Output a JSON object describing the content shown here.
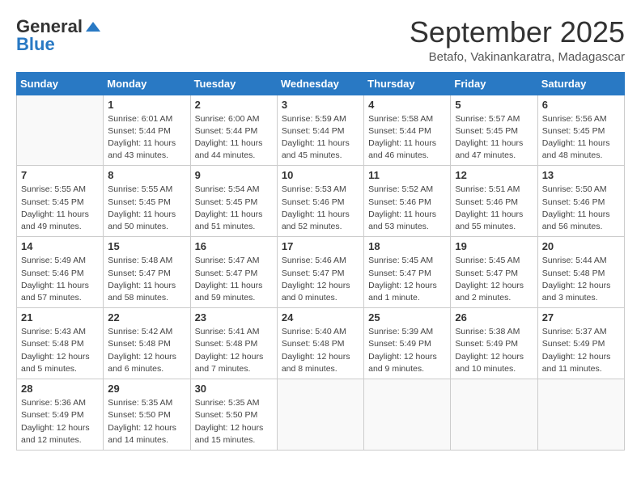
{
  "header": {
    "logo_general": "General",
    "logo_blue": "Blue",
    "month": "September 2025",
    "location": "Betafo, Vakinankaratra, Madagascar"
  },
  "weekdays": [
    "Sunday",
    "Monday",
    "Tuesday",
    "Wednesday",
    "Thursday",
    "Friday",
    "Saturday"
  ],
  "weeks": [
    [
      {
        "day": "",
        "sunrise": "",
        "sunset": "",
        "daylight": ""
      },
      {
        "day": "1",
        "sunrise": "Sunrise: 6:01 AM",
        "sunset": "Sunset: 5:44 PM",
        "daylight": "Daylight: 11 hours and 43 minutes."
      },
      {
        "day": "2",
        "sunrise": "Sunrise: 6:00 AM",
        "sunset": "Sunset: 5:44 PM",
        "daylight": "Daylight: 11 hours and 44 minutes."
      },
      {
        "day": "3",
        "sunrise": "Sunrise: 5:59 AM",
        "sunset": "Sunset: 5:44 PM",
        "daylight": "Daylight: 11 hours and 45 minutes."
      },
      {
        "day": "4",
        "sunrise": "Sunrise: 5:58 AM",
        "sunset": "Sunset: 5:44 PM",
        "daylight": "Daylight: 11 hours and 46 minutes."
      },
      {
        "day": "5",
        "sunrise": "Sunrise: 5:57 AM",
        "sunset": "Sunset: 5:45 PM",
        "daylight": "Daylight: 11 hours and 47 minutes."
      },
      {
        "day": "6",
        "sunrise": "Sunrise: 5:56 AM",
        "sunset": "Sunset: 5:45 PM",
        "daylight": "Daylight: 11 hours and 48 minutes."
      }
    ],
    [
      {
        "day": "7",
        "sunrise": "Sunrise: 5:55 AM",
        "sunset": "Sunset: 5:45 PM",
        "daylight": "Daylight: 11 hours and 49 minutes."
      },
      {
        "day": "8",
        "sunrise": "Sunrise: 5:55 AM",
        "sunset": "Sunset: 5:45 PM",
        "daylight": "Daylight: 11 hours and 50 minutes."
      },
      {
        "day": "9",
        "sunrise": "Sunrise: 5:54 AM",
        "sunset": "Sunset: 5:45 PM",
        "daylight": "Daylight: 11 hours and 51 minutes."
      },
      {
        "day": "10",
        "sunrise": "Sunrise: 5:53 AM",
        "sunset": "Sunset: 5:46 PM",
        "daylight": "Daylight: 11 hours and 52 minutes."
      },
      {
        "day": "11",
        "sunrise": "Sunrise: 5:52 AM",
        "sunset": "Sunset: 5:46 PM",
        "daylight": "Daylight: 11 hours and 53 minutes."
      },
      {
        "day": "12",
        "sunrise": "Sunrise: 5:51 AM",
        "sunset": "Sunset: 5:46 PM",
        "daylight": "Daylight: 11 hours and 55 minutes."
      },
      {
        "day": "13",
        "sunrise": "Sunrise: 5:50 AM",
        "sunset": "Sunset: 5:46 PM",
        "daylight": "Daylight: 11 hours and 56 minutes."
      }
    ],
    [
      {
        "day": "14",
        "sunrise": "Sunrise: 5:49 AM",
        "sunset": "Sunset: 5:46 PM",
        "daylight": "Daylight: 11 hours and 57 minutes."
      },
      {
        "day": "15",
        "sunrise": "Sunrise: 5:48 AM",
        "sunset": "Sunset: 5:47 PM",
        "daylight": "Daylight: 11 hours and 58 minutes."
      },
      {
        "day": "16",
        "sunrise": "Sunrise: 5:47 AM",
        "sunset": "Sunset: 5:47 PM",
        "daylight": "Daylight: 11 hours and 59 minutes."
      },
      {
        "day": "17",
        "sunrise": "Sunrise: 5:46 AM",
        "sunset": "Sunset: 5:47 PM",
        "daylight": "Daylight: 12 hours and 0 minutes."
      },
      {
        "day": "18",
        "sunrise": "Sunrise: 5:45 AM",
        "sunset": "Sunset: 5:47 PM",
        "daylight": "Daylight: 12 hours and 1 minute."
      },
      {
        "day": "19",
        "sunrise": "Sunrise: 5:45 AM",
        "sunset": "Sunset: 5:47 PM",
        "daylight": "Daylight: 12 hours and 2 minutes."
      },
      {
        "day": "20",
        "sunrise": "Sunrise: 5:44 AM",
        "sunset": "Sunset: 5:48 PM",
        "daylight": "Daylight: 12 hours and 3 minutes."
      }
    ],
    [
      {
        "day": "21",
        "sunrise": "Sunrise: 5:43 AM",
        "sunset": "Sunset: 5:48 PM",
        "daylight": "Daylight: 12 hours and 5 minutes."
      },
      {
        "day": "22",
        "sunrise": "Sunrise: 5:42 AM",
        "sunset": "Sunset: 5:48 PM",
        "daylight": "Daylight: 12 hours and 6 minutes."
      },
      {
        "day": "23",
        "sunrise": "Sunrise: 5:41 AM",
        "sunset": "Sunset: 5:48 PM",
        "daylight": "Daylight: 12 hours and 7 minutes."
      },
      {
        "day": "24",
        "sunrise": "Sunrise: 5:40 AM",
        "sunset": "Sunset: 5:48 PM",
        "daylight": "Daylight: 12 hours and 8 minutes."
      },
      {
        "day": "25",
        "sunrise": "Sunrise: 5:39 AM",
        "sunset": "Sunset: 5:49 PM",
        "daylight": "Daylight: 12 hours and 9 minutes."
      },
      {
        "day": "26",
        "sunrise": "Sunrise: 5:38 AM",
        "sunset": "Sunset: 5:49 PM",
        "daylight": "Daylight: 12 hours and 10 minutes."
      },
      {
        "day": "27",
        "sunrise": "Sunrise: 5:37 AM",
        "sunset": "Sunset: 5:49 PM",
        "daylight": "Daylight: 12 hours and 11 minutes."
      }
    ],
    [
      {
        "day": "28",
        "sunrise": "Sunrise: 5:36 AM",
        "sunset": "Sunset: 5:49 PM",
        "daylight": "Daylight: 12 hours and 12 minutes."
      },
      {
        "day": "29",
        "sunrise": "Sunrise: 5:35 AM",
        "sunset": "Sunset: 5:50 PM",
        "daylight": "Daylight: 12 hours and 14 minutes."
      },
      {
        "day": "30",
        "sunrise": "Sunrise: 5:35 AM",
        "sunset": "Sunset: 5:50 PM",
        "daylight": "Daylight: 12 hours and 15 minutes."
      },
      {
        "day": "",
        "sunrise": "",
        "sunset": "",
        "daylight": ""
      },
      {
        "day": "",
        "sunrise": "",
        "sunset": "",
        "daylight": ""
      },
      {
        "day": "",
        "sunrise": "",
        "sunset": "",
        "daylight": ""
      },
      {
        "day": "",
        "sunrise": "",
        "sunset": "",
        "daylight": ""
      }
    ]
  ]
}
